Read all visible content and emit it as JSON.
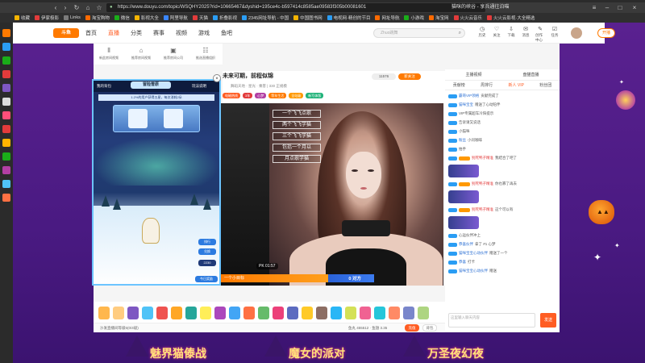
{
  "browser": {
    "url": "https://www.douyu.com/topic/WSQHY2025?rid=10665467&dyshid=195ce4c-b597414c8585ae09583f305b00081601",
    "tab_title": "猫咪的峡谷 - 享兵通往泊喵",
    "bookmarks": [
      "收藏",
      "伊家极影",
      "Links",
      "淘宝购物",
      "微信",
      "影视大全",
      "阿里导航",
      "天猫",
      "折叠影视",
      "2345网址导航 - 中国",
      "中国图书网",
      "电视网·精创的节目",
      "网址导航",
      "小游戏",
      "淘宝网",
      "火火云音乐",
      "火火云影视·大全精选"
    ],
    "bookmark_colors": [
      "#f5b400",
      "#e23b3b",
      "#7b7b7b",
      "#ff6a00",
      "#1aad19",
      "#f5b400",
      "#3a86ff",
      "#e23b3b",
      "#2a9df4",
      "#2a9df4",
      "#f5b400",
      "#2a9df4",
      "#ff6a00",
      "#1aad19",
      "#ff6a00",
      "#e23b3b",
      "#e23b3b"
    ]
  },
  "header": {
    "logo": "斗鱼",
    "nav": [
      "首页",
      "直播",
      "分类",
      "赛事",
      "视频",
      "游戏",
      "鱼吧"
    ],
    "active_nav": "直播",
    "search_placeholder": "Zhuo跳舞",
    "icons": [
      {
        "icon": "history-icon",
        "label": "历史"
      },
      {
        "icon": "follow-icon",
        "label": "关注"
      },
      {
        "icon": "download-icon",
        "label": "下载"
      },
      {
        "icon": "message-icon",
        "label": "消息"
      },
      {
        "icon": "creator-icon",
        "label": "创作中心"
      },
      {
        "icon": "task-icon",
        "label": "任务"
      }
    ],
    "open_stream": "开播"
  },
  "subtools": [
    "新此房间视频",
    "推荐房间视频",
    "推荐房间公司",
    "推选直播组织"
  ],
  "room": {
    "title": "未来可期，前程似锦",
    "room_id": "10665467",
    "meta": "舞蹈天地 · 星光 · 乘客 | 330 正规模",
    "follow_count": "11576",
    "follow_label": "新关注",
    "badges": [
      {
        "text": "电磁热线",
        "color": "#ff5d23"
      },
      {
        "text": "3年",
        "color": "#e23b3b"
      },
      {
        "text": "心梦",
        "color": "#b23fa4"
      },
      {
        "text": "等年生活",
        "color": "#ff7a00"
      },
      {
        "text": "全站级",
        "color": "#ff9900"
      },
      {
        "text": "新写体版",
        "color": "#22b37a"
      }
    ]
  },
  "video": {
    "songs": [
      "一个飞飞点歌",
      "两个飞飞学猫",
      "三个飞飞学猫",
      "包括一个月以",
      "月点歌学猫"
    ],
    "pk_timer": "PK 01:57",
    "pk_left": "一个小目标",
    "pk_right": "0 对方",
    "room_id_overlay": "10665467"
  },
  "gifts": {
    "colors": [
      "#ffb74d",
      "#ffcc80",
      "#7e57c2",
      "#4fc3f7",
      "#ef5350",
      "#ffa726",
      "#26a69a",
      "#ffee58",
      "#ab47bc",
      "#42a5f5",
      "#ff7043",
      "#66bb6a",
      "#ec407a",
      "#5c6bc0",
      "#ffca28",
      "#8d6e63",
      "#29b6f6",
      "#d4e157",
      "#f06292",
      "#26c6da",
      "#ff8a65",
      "#7986cb",
      "#aed581"
    ],
    "foot_left": "沙发直播间等级5(0/4级)",
    "foot_mid": "鱼丸 455512 · 鱼翅 3.35",
    "recharge": "充值",
    "package": "背包"
  },
  "chat": {
    "top": [
      "主播视频",
      "盘猫直播"
    ],
    "tabs": [
      "贡献榜",
      "周排行",
      "新人 VIP",
      "粉丝团"
    ],
    "active_tab": "新人 VIP",
    "messages": [
      {
        "user": "霸哥VIP领格",
        "text": "贡献完成了"
      },
      {
        "user": "猫咪宝宝",
        "text": "赠送了心动陪伴"
      },
      {
        "user": "",
        "text": "VIP专属超车冷阳提示"
      },
      {
        "user": "",
        "text": "告诉请又说话"
      },
      {
        "user": "",
        "text": "小猫咪"
      },
      {
        "user": "粉丝",
        "text": "小问咖啡"
      },
      {
        "user": "",
        "text": "拍手"
      },
      {
        "user": "别死鸭子精准",
        "text": "我结合了吧了",
        "card": true
      },
      {
        "user": "别死鸭子精准",
        "text": "你也寡了再去",
        "card": true
      },
      {
        "user": "别死鸭子精准",
        "text": "这个可以有",
        "card": true
      },
      {
        "user": "",
        "text": "心运伙伴冲上"
      },
      {
        "user": "恭喜伙伴",
        "text": "拿了 #1 心梦"
      },
      {
        "user": "猫咪宝宝心动伙伴",
        "text": "赠送了一个"
      },
      {
        "user": "恭喜",
        "text": "打卡"
      },
      {
        "user": "猫咪宝宝心动伙伴",
        "text": "赠送"
      }
    ],
    "input_placeholder": "这里输入聊天内容",
    "send": "发送"
  },
  "game": {
    "title": "冒险雪原",
    "left_tab": "我的背包",
    "right_tab": "玩法说明",
    "banner": "1.2%的用户获得五星，每次消耗2朵",
    "buttons": [
      "排行",
      "兑换",
      "今日奖励"
    ],
    "counter": "2230"
  },
  "bottom_banners": [
    "魅界猫傣战",
    "魔女的派对",
    "万圣夜幻夜"
  ]
}
